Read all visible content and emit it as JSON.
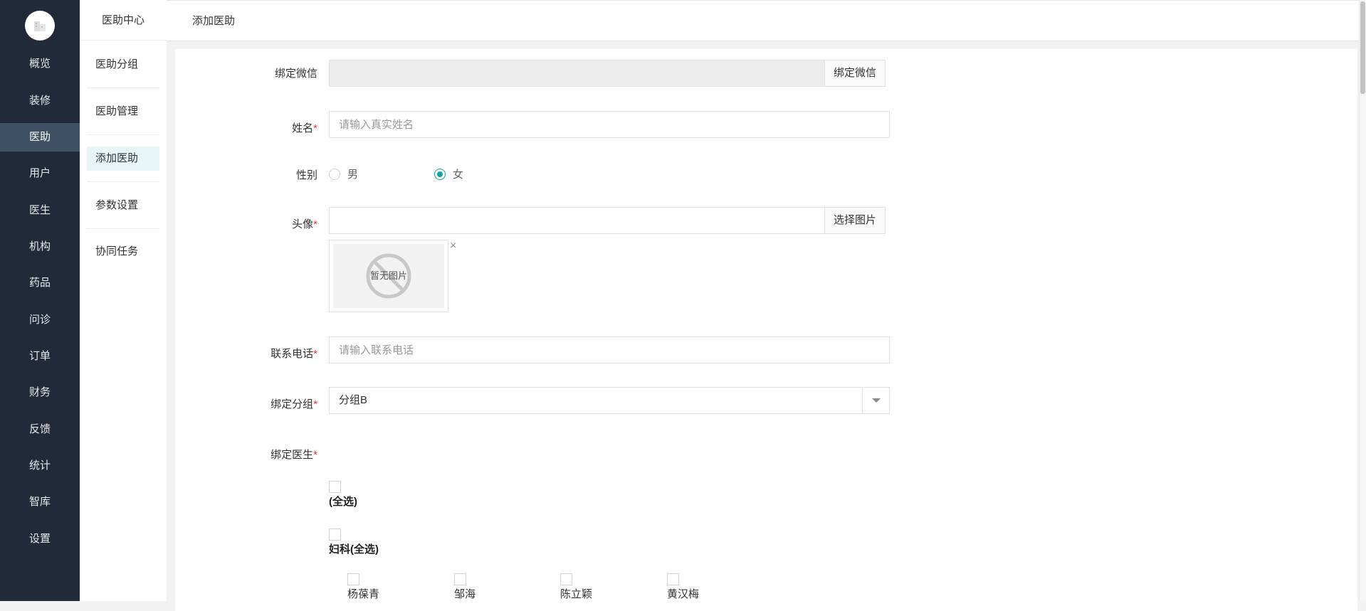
{
  "main_nav": {
    "items": [
      {
        "label": "概览"
      },
      {
        "label": "装修"
      },
      {
        "label": "医助"
      },
      {
        "label": "用户"
      },
      {
        "label": "医生"
      },
      {
        "label": "机构"
      },
      {
        "label": "药品"
      },
      {
        "label": "问诊"
      },
      {
        "label": "订单"
      },
      {
        "label": "财务"
      },
      {
        "label": "反馈"
      },
      {
        "label": "统计"
      },
      {
        "label": "智库"
      },
      {
        "label": "设置"
      }
    ],
    "active": "医助"
  },
  "sub_nav": {
    "title": "医助中心",
    "items": [
      {
        "label": "医助分组"
      },
      {
        "label": "医助管理"
      },
      {
        "label": "添加医助"
      },
      {
        "label": "参数设置"
      },
      {
        "label": "协同任务"
      }
    ],
    "active": "添加医助"
  },
  "header": {
    "title": "添加医助"
  },
  "form": {
    "wechat": {
      "label": "绑定微信",
      "value": "",
      "button": "绑定微信"
    },
    "name": {
      "label": "姓名",
      "required_mark": "*",
      "placeholder": "请输入真实姓名"
    },
    "gender": {
      "label": "性别",
      "options": [
        "男",
        "女"
      ],
      "selected": "女"
    },
    "avatar": {
      "label": "头像",
      "required_mark": "*",
      "value": "",
      "button": "选择图片",
      "empty_text": "暂无图片",
      "remove_icon": "×"
    },
    "phone": {
      "label": "联系电话",
      "required_mark": "*",
      "placeholder": "请输入联系电话"
    },
    "group": {
      "label": "绑定分组",
      "required_mark": "*",
      "selected": "分组B"
    },
    "doctor": {
      "label": "绑定医生",
      "required_mark": "*",
      "select_all": "(全选)",
      "departments": [
        {
          "name": "妇科(全选)",
          "doctors": [
            "杨葆青",
            "邹海",
            "陈立颖",
            "黄汉梅"
          ]
        }
      ]
    }
  },
  "colors": {
    "sidebar_bg": "#222a3a",
    "sidebar_active": "#3e5163",
    "accent": "#12a3a3",
    "required": "#e4393c"
  }
}
